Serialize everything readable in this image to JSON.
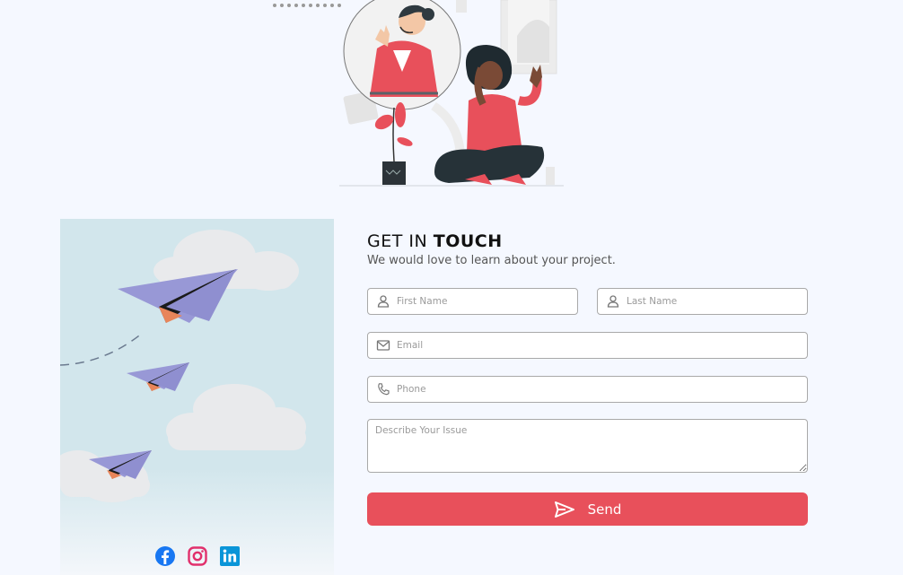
{
  "contact": {
    "title_light": "GET IN",
    "title_bold": "TOUCH",
    "subtitle": "We would love to learn about your project."
  },
  "form": {
    "first_name": {
      "placeholder": "First Name",
      "value": ""
    },
    "last_name": {
      "placeholder": "Last Name",
      "value": ""
    },
    "email": {
      "placeholder": "Email",
      "value": ""
    },
    "phone": {
      "placeholder": "Phone",
      "value": ""
    },
    "issue": {
      "placeholder": "Describe Your Issue",
      "value": ""
    },
    "send_label": "Send"
  },
  "socials": [
    {
      "name": "facebook",
      "icon": "facebook-icon",
      "color": "#1877f2"
    },
    {
      "name": "instagram",
      "icon": "instagram-icon",
      "color": "#e1306c"
    },
    {
      "name": "linkedin",
      "icon": "linkedin-icon",
      "color": "#0a95d8"
    }
  ],
  "colors": {
    "accent": "#e8505b",
    "page_bg": "#f5f8ff",
    "panel_sky": "#d2e6ec",
    "plane": "#8f8fd0"
  }
}
